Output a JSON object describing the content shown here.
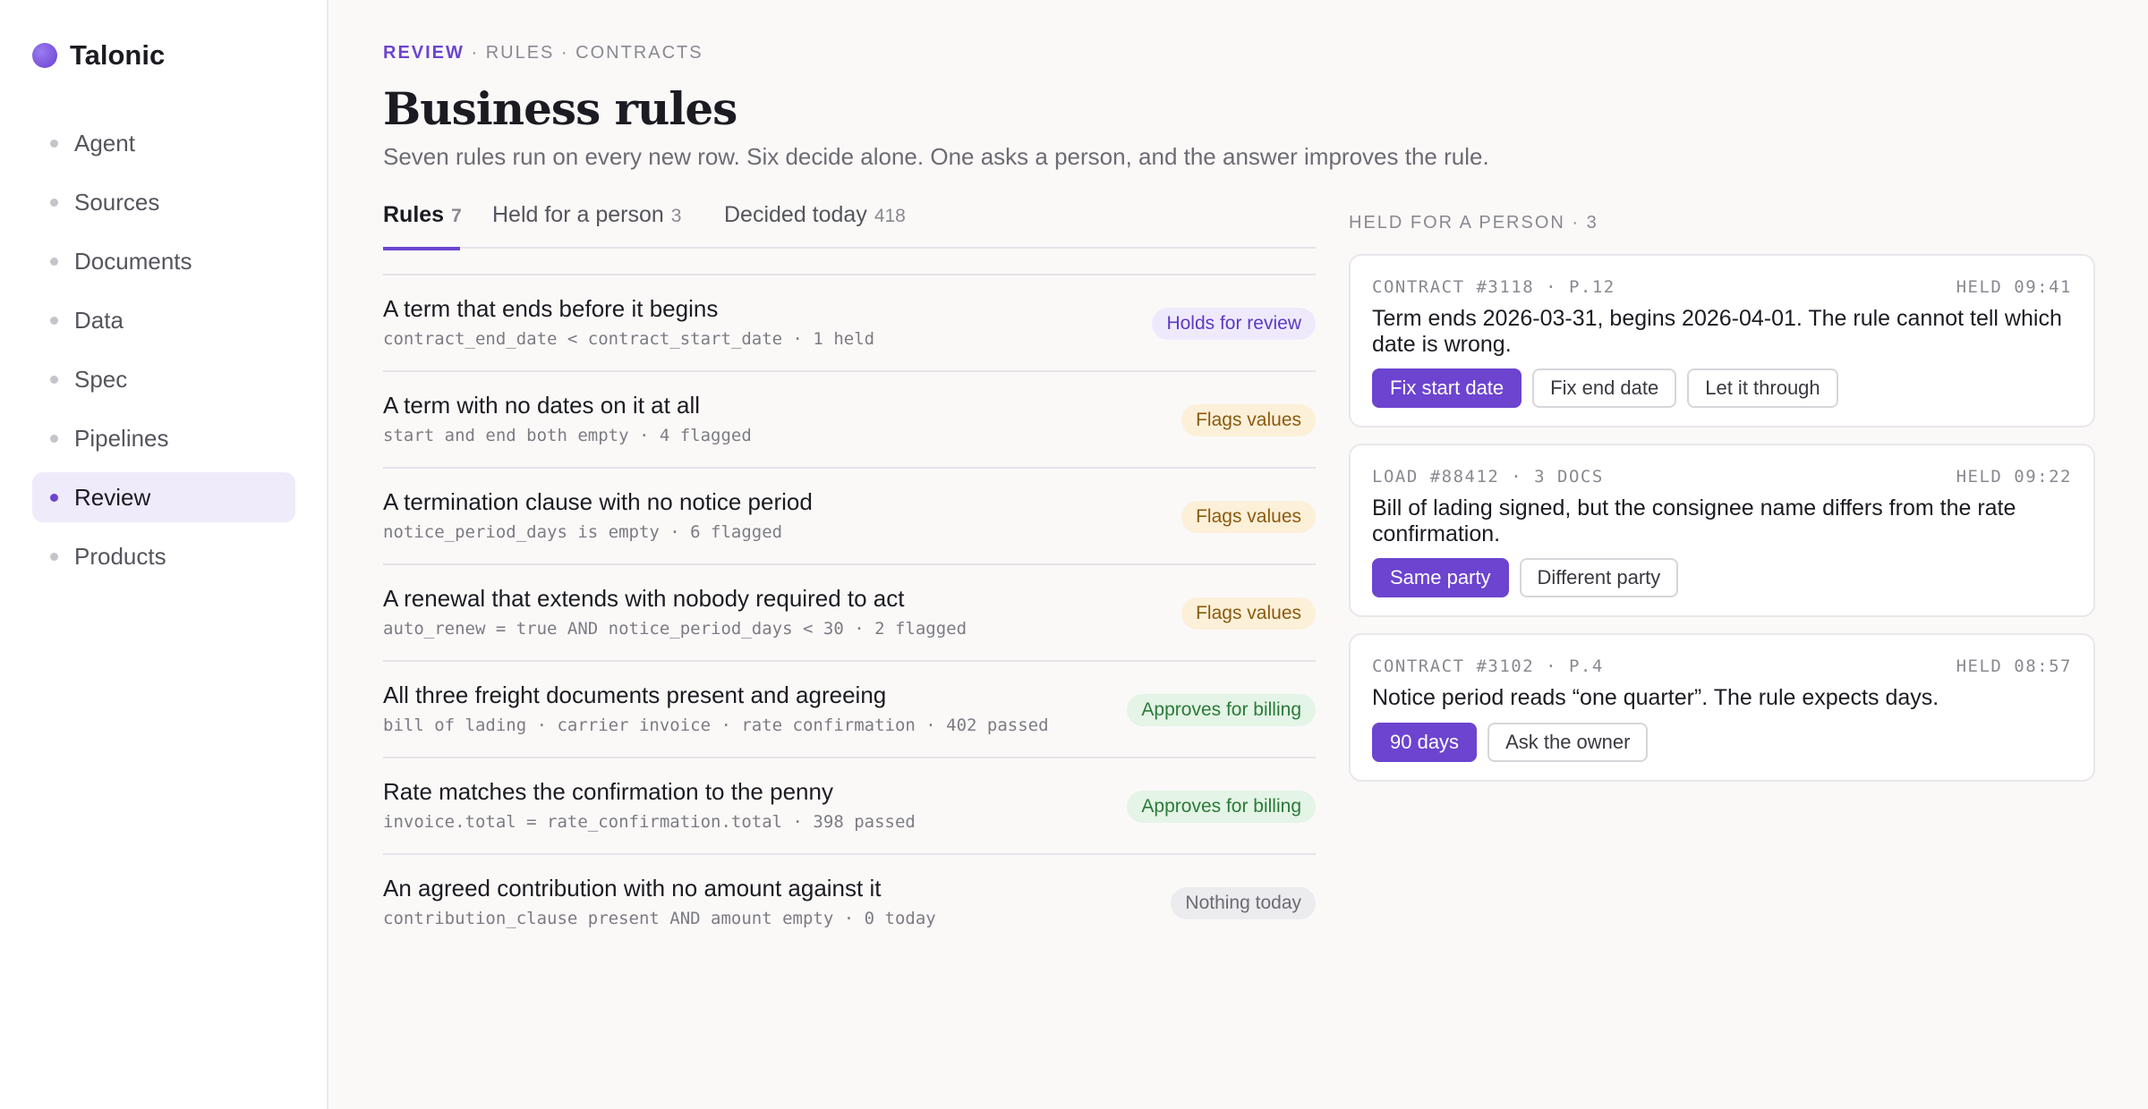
{
  "app": {
    "name": "Talonic"
  },
  "nav": [
    {
      "label": "Agent",
      "active": false
    },
    {
      "label": "Sources",
      "active": false
    },
    {
      "label": "Documents",
      "active": false
    },
    {
      "label": "Data",
      "active": false
    },
    {
      "label": "Spec",
      "active": false
    },
    {
      "label": "Pipelines",
      "active": false
    },
    {
      "label": "Review",
      "active": true
    },
    {
      "label": "Products",
      "active": false
    }
  ],
  "breadcrumb": {
    "current": "REVIEW",
    "sep1": " · ",
    "b2": "RULES",
    "sep2": " · ",
    "b3": "CONTRACTS"
  },
  "page": {
    "title": "Business rules",
    "subtitle": "Seven rules run on every new row. Six decide alone. One asks a person, and the answer improves the rule."
  },
  "tabs": [
    {
      "label": "Rules",
      "count": "7",
      "active": true
    },
    {
      "label": "Held for a person",
      "count": "3",
      "active": false
    },
    {
      "label": "Decided today",
      "count": "418",
      "active": false
    }
  ],
  "rules": [
    {
      "title": "A term that ends before it begins",
      "sub": "contract_end_date < contract_start_date · 1 held",
      "pill": "Holds for review",
      "kind": "review"
    },
    {
      "title": "A term with no dates on it at all",
      "sub": "start and end both empty · 4 flagged",
      "pill": "Flags values",
      "kind": "flag"
    },
    {
      "title": "A termination clause with no notice period",
      "sub": "notice_period_days is empty · 6 flagged",
      "pill": "Flags values",
      "kind": "flag"
    },
    {
      "title": "A renewal that extends with nobody required to act",
      "sub": "auto_renew = true AND notice_period_days < 30 · 2 flagged",
      "pill": "Flags values",
      "kind": "flag"
    },
    {
      "title": "All three freight documents present and agreeing",
      "sub": "bill of lading · carrier invoice · rate confirmation · 402 passed",
      "pill": "Approves for billing",
      "kind": "approve"
    },
    {
      "title": "Rate matches the confirmation to the penny",
      "sub": "invoice.total = rate_confirmation.total · 398 passed",
      "pill": "Approves for billing",
      "kind": "approve"
    },
    {
      "title": "An agreed contribution with no amount against it",
      "sub": "contribution_clause present AND amount empty · 0 today",
      "pill": "Nothing today",
      "kind": "nothing"
    }
  ],
  "held": {
    "header": "HELD FOR A PERSON · 3",
    "cards": [
      {
        "meta": "CONTRACT #3118 · P.12",
        "time": "HELD 09:41",
        "text": "Term ends 2026-03-31, begins 2026-04-01. The rule cannot tell which date is wrong.",
        "actions": [
          {
            "label": "Fix start date",
            "primary": true
          },
          {
            "label": "Fix end date",
            "primary": false
          },
          {
            "label": "Let it through",
            "primary": false
          }
        ]
      },
      {
        "meta": "LOAD #88412 · 3 DOCS",
        "time": "HELD 09:22",
        "text": "Bill of lading signed, but the consignee name differs from the rate confirmation.",
        "actions": [
          {
            "label": "Same party",
            "primary": true
          },
          {
            "label": "Different party",
            "primary": false
          }
        ]
      },
      {
        "meta": "CONTRACT #3102 · P.4",
        "time": "HELD 08:57",
        "text": "Notice period reads “one quarter”. The rule expects days.",
        "actions": [
          {
            "label": "90 days",
            "primary": true
          },
          {
            "label": "Ask the owner",
            "primary": false
          }
        ]
      }
    ]
  },
  "colors": {
    "accent": "#6c44cf",
    "background": "#faf9f8",
    "sidebar": "#ffffff"
  }
}
